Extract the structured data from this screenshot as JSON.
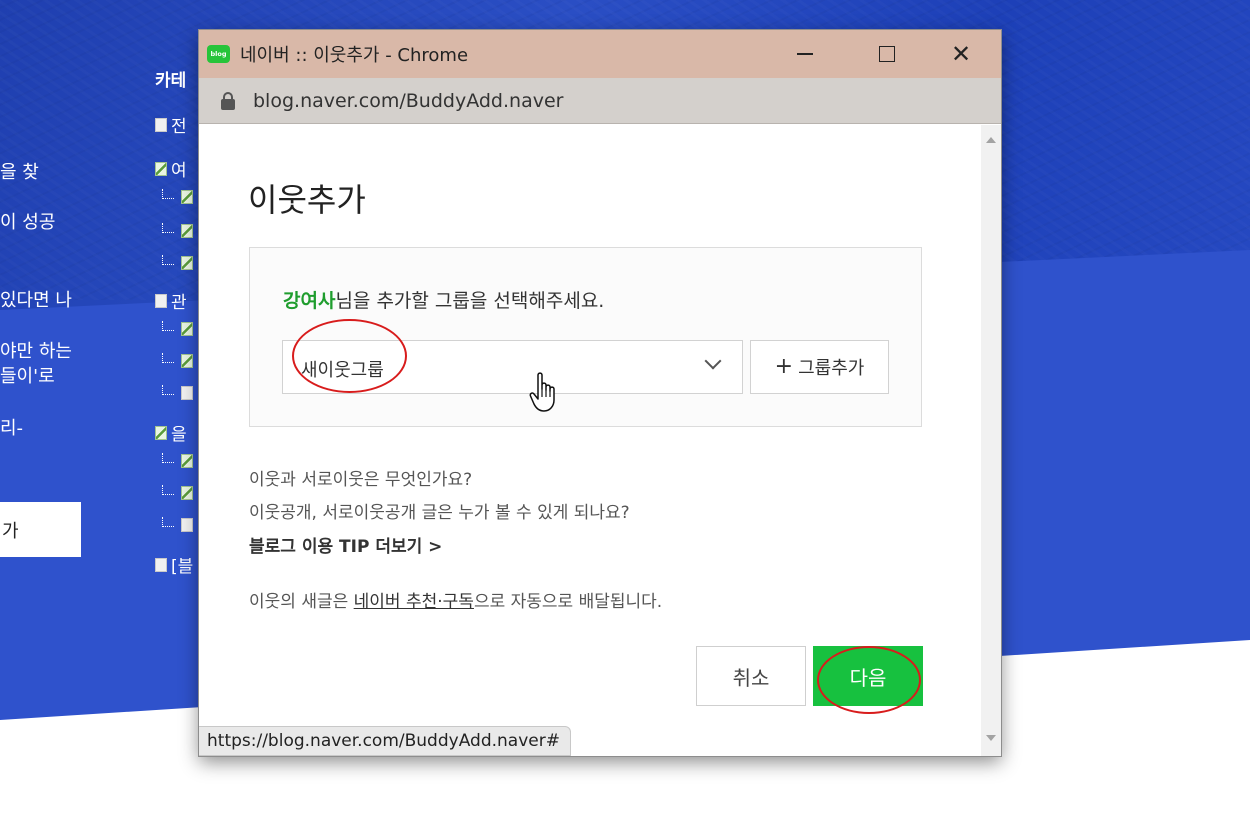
{
  "background": {
    "category_header": "카테",
    "left_text": [
      "을 찾",
      "이 성공",
      "있다면 나",
      "야만 하는",
      "들이'로",
      "리-"
    ],
    "left_button": "가",
    "categories": [
      {
        "icon": "doc",
        "text": "전"
      },
      {
        "icon": "leaf",
        "text": "여"
      },
      {
        "icon": "leaf-sub",
        "text": ""
      },
      {
        "icon": "leaf-sub",
        "text": ""
      },
      {
        "icon": "leaf-sub",
        "text": ""
      },
      {
        "icon": "doc",
        "text": "관"
      },
      {
        "icon": "leaf-sub",
        "text": ""
      },
      {
        "icon": "leaf-sub",
        "text": ""
      },
      {
        "icon": "doc-sub",
        "text": ""
      },
      {
        "icon": "leaf",
        "text": "을"
      },
      {
        "icon": "leaf-sub",
        "text": ""
      },
      {
        "icon": "leaf-sub",
        "text": ""
      },
      {
        "icon": "doc-sub",
        "text": ""
      },
      {
        "icon": "doc",
        "text": "[블"
      }
    ]
  },
  "window": {
    "favicon_label": "blog",
    "title": "네이버 :: 이웃추가 - Chrome",
    "minimize_label": "",
    "close_label": "✕",
    "url": "blog.naver.com/BuddyAdd.naver"
  },
  "dialog": {
    "heading": "이웃추가",
    "prompt_name": "강여사",
    "prompt_rest": "님을 추가할 그룹을 선택해주세요.",
    "group_select_value": "새이웃그룹",
    "add_group_plus": "+",
    "add_group_label": "그룹추가",
    "faq_1": "이웃과 서로이웃은 무엇인가요?",
    "faq_2": "이웃공개, 서로이웃공개 글은 누가 볼 수 있게 되나요?",
    "tip_link": "블로그 이용 TIP 더보기 >",
    "delivery_prefix": "이웃의 새글은 ",
    "delivery_link": "네이버 추천·구독",
    "delivery_suffix": "으로 자동으로 배달됩니다.",
    "cancel_label": "취소",
    "next_label": "다음"
  },
  "status_bar": {
    "url": "https://blog.naver.com/BuddyAdd.naver#"
  },
  "colors": {
    "accent_green": "#17c13f",
    "name_green": "#1f9d2e",
    "annotation_red": "#d81c1c",
    "titlebar": "#d9b8a8",
    "background_blue": "#2a47b8"
  }
}
